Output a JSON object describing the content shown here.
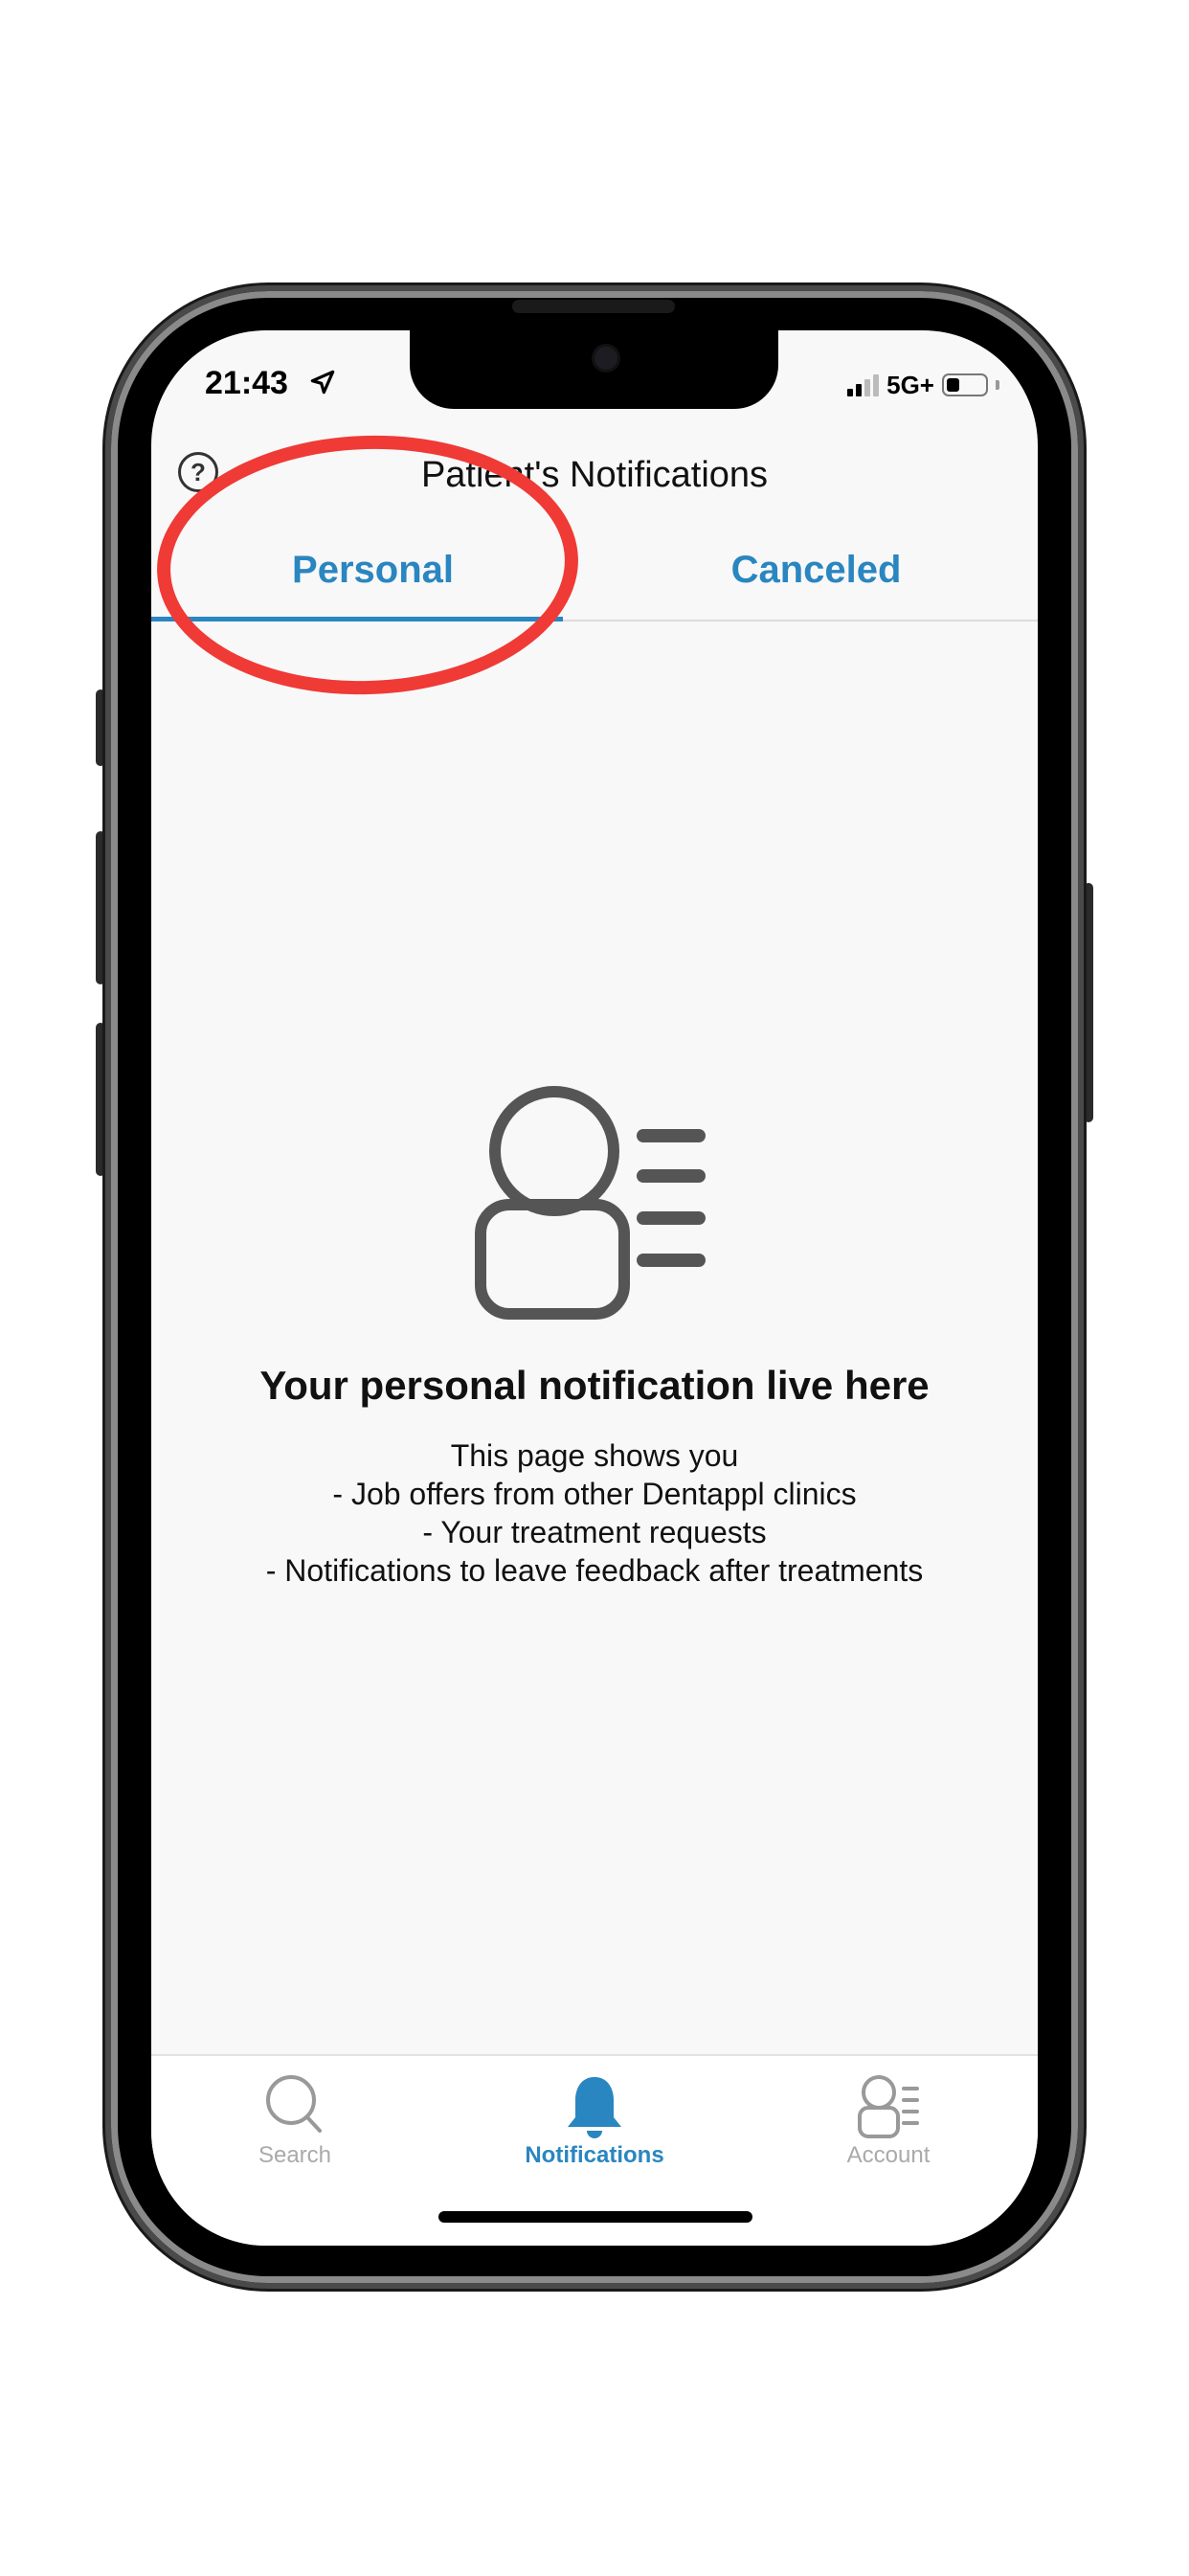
{
  "status_bar": {
    "time": "21:43",
    "network": "5G+"
  },
  "header": {
    "title": "Patient's Notifications",
    "help_label": "?"
  },
  "tabs": [
    {
      "label": "Personal",
      "selected": true
    },
    {
      "label": "Canceled",
      "selected": false
    }
  ],
  "empty_state": {
    "title": "Your personal notification live here",
    "lines": [
      "This page shows you",
      "- Job offers from other Dentappl clinics",
      "- Your treatment requests",
      "- Notifications to leave feedback after treatments"
    ]
  },
  "tab_bar": {
    "items": [
      {
        "label": "Search",
        "icon": "search-icon",
        "active": false
      },
      {
        "label": "Notifications",
        "icon": "bell-icon",
        "active": true
      },
      {
        "label": "Account",
        "icon": "account-icon",
        "active": false
      }
    ]
  },
  "colors": {
    "accent": "#2a86c0",
    "annotation": "#ef3a36",
    "background": "#f8f8f8"
  }
}
